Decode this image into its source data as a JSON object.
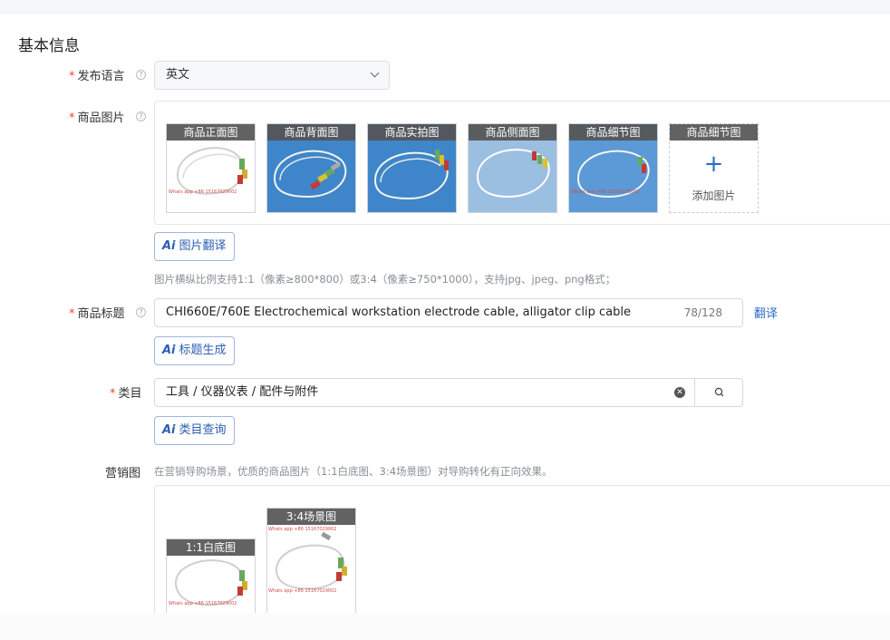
{
  "section": {
    "title": "基本信息"
  },
  "language": {
    "label": "发布语言",
    "value": "英文"
  },
  "images": {
    "label": "商品图片",
    "items": [
      {
        "caption": "商品正面图",
        "variant": "white"
      },
      {
        "caption": "商品背面图",
        "variant": "blue"
      },
      {
        "caption": "商品实拍图",
        "variant": "blue"
      },
      {
        "caption": "商品侧面图",
        "variant": "blue"
      },
      {
        "caption": "商品细节图",
        "variant": "blue"
      }
    ],
    "add_slot": {
      "caption": "商品细节图",
      "plus": "+",
      "text": "添加图片"
    },
    "watermark": "Whats app +86 15167029002",
    "translate_button": "图片翻译",
    "hint": "图片横纵比例支持1:1（像素≥800*800）或3:4（像素≥750*1000），支持jpg、jpeg、png格式；"
  },
  "title": {
    "label": "商品标题",
    "value": "CHI660E/760E Electrochemical workstation electrode cable, alligator clip cable",
    "count": "78/128",
    "translate_link": "翻译",
    "generate_button": "标题生成"
  },
  "category": {
    "label": "类目",
    "value": "工具 / 仪器仪表 / 配件与附件",
    "query_button": "类目查询"
  },
  "marketing": {
    "label": "营销图",
    "hint": "在营销导购场景，优质的商品图片（1:1白底图、3:4场景图）对导购转化有正向效果。",
    "items": [
      {
        "caption": "1:1白底图"
      },
      {
        "caption": "3:4场景图"
      }
    ]
  },
  "ai_mark": "Ai",
  "colors": {
    "accent": "#2b6cc4",
    "required": "#e34d2b",
    "thumb_blue": "#3e86c9"
  }
}
